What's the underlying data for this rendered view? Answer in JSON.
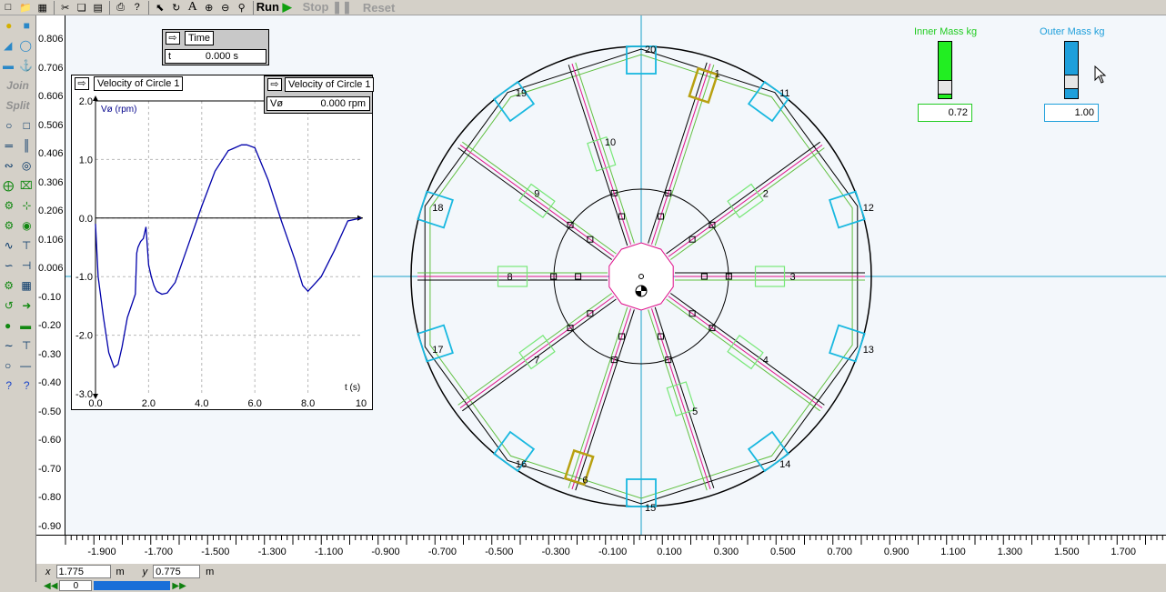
{
  "toolbar": {
    "run": "Run",
    "stop": "Stop",
    "reset": "Reset"
  },
  "palette": {
    "join": "Join",
    "split": "Split"
  },
  "vruler": {
    "labels": [
      "0.806",
      "0.706",
      "0.606",
      "0.506",
      "0.406",
      "0.306",
      "0.206",
      "0.106",
      "0.006",
      "-0.10",
      "-0.20",
      "-0.30",
      "-0.40",
      "-0.50",
      "-0.60",
      "-0.70",
      "-0.80",
      "-0.90"
    ]
  },
  "hruler": {
    "labels": [
      "-1.900",
      "-1.700",
      "-1.500",
      "-1.300",
      "-1.100",
      "-0.900",
      "-0.700",
      "-0.500",
      "-0.300",
      "-0.100",
      "0.100",
      "0.300",
      "0.500",
      "0.700",
      "0.900",
      "1.100",
      "1.300",
      "1.500",
      "1.700"
    ]
  },
  "time_meter": {
    "title": "Time",
    "key": "t",
    "value": "0.000 s"
  },
  "velocity_meter": {
    "title": "Velocity of Circle 1",
    "key": "Vø",
    "value": "0.000 rpm"
  },
  "graph_meter": {
    "title": "Velocity of Circle 1"
  },
  "chart_data": {
    "type": "line",
    "title": "",
    "xlabel": "t (s)",
    "ylabel": "Vø (rpm)",
    "xlim": [
      0,
      10
    ],
    "ylim": [
      -3,
      2
    ],
    "x_ticks": [
      "0.0",
      "2.0",
      "4.0",
      "6.0",
      "8.0",
      "10"
    ],
    "y_ticks": [
      "2.0",
      "1.0",
      "0.0",
      "-1.0",
      "-2.0",
      "-3.0"
    ],
    "grid": true,
    "series": [
      {
        "color": "#0000aa",
        "x": [
          0.0,
          0.1,
          0.3,
          0.5,
          0.7,
          0.85,
          1.0,
          1.2,
          1.5,
          1.55,
          1.6,
          1.7,
          1.8,
          1.9,
          2.0,
          2.1,
          2.2,
          2.3,
          2.5,
          2.7,
          3.0,
          3.5,
          4.0,
          4.5,
          5.0,
          5.5,
          5.7,
          6.0,
          6.5,
          7.0,
          7.5,
          7.8,
          8.0,
          8.5,
          9.0,
          9.5,
          10.0
        ],
        "y": [
          -0.1,
          -1.0,
          -1.7,
          -2.3,
          -2.55,
          -2.5,
          -2.2,
          -1.7,
          -1.3,
          -0.6,
          -0.5,
          -0.4,
          -0.35,
          -0.15,
          -0.8,
          -1.0,
          -1.15,
          -1.25,
          -1.3,
          -1.28,
          -1.1,
          -0.45,
          0.2,
          0.8,
          1.15,
          1.25,
          1.25,
          1.2,
          0.65,
          -0.05,
          -0.7,
          -1.15,
          -1.25,
          -1.0,
          -0.55,
          -0.05,
          0.0
        ]
      }
    ]
  },
  "inner_mass": {
    "label": "Inner Mass kg",
    "value": "0.72",
    "color": "#00cc00"
  },
  "outer_mass": {
    "label": "Outer Mass kg",
    "value": "1.00",
    "color": "#1e9fdb"
  },
  "spokes": {
    "labels": [
      "1",
      "2",
      "3",
      "4",
      "5",
      "6",
      "7",
      "8",
      "9",
      "10"
    ],
    "rim_labels": [
      "11",
      "12",
      "13",
      "14",
      "15",
      "16",
      "17",
      "18",
      "19",
      "20"
    ]
  },
  "status": {
    "x_label": "x",
    "x_value": "1.775",
    "x_unit": "m",
    "y_label": "y",
    "y_value": "0.775",
    "y_unit": "m"
  },
  "scrollbar": {
    "frame": "0"
  }
}
